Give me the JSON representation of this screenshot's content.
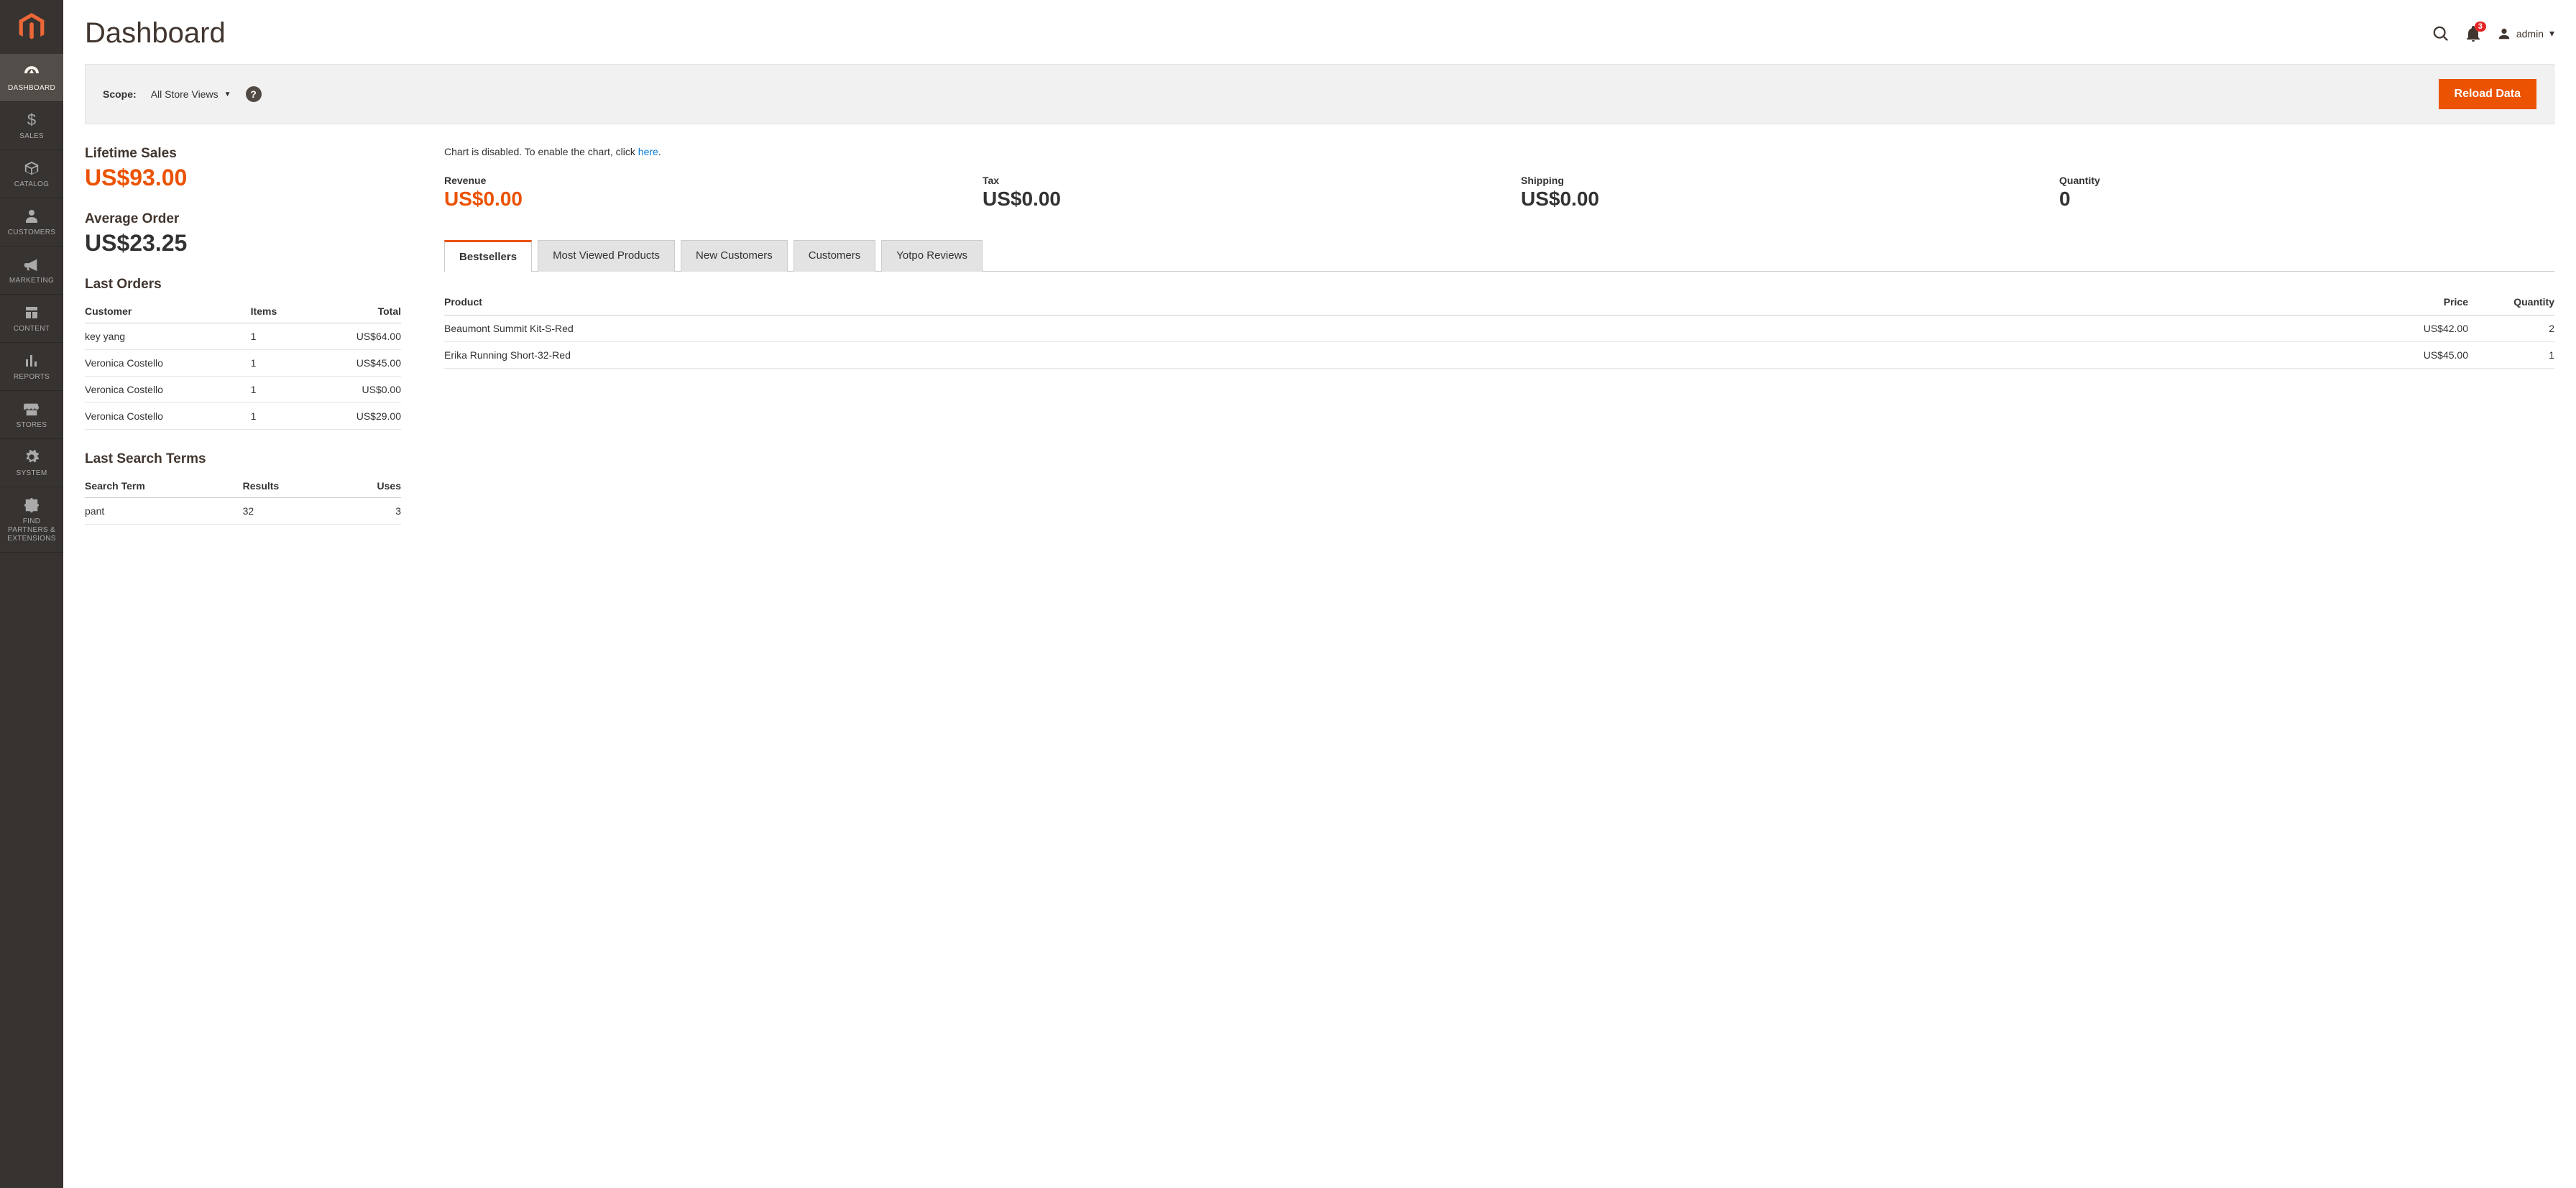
{
  "sidebar": {
    "items": [
      {
        "label": "DASHBOARD"
      },
      {
        "label": "SALES"
      },
      {
        "label": "CATALOG"
      },
      {
        "label": "CUSTOMERS"
      },
      {
        "label": "MARKETING"
      },
      {
        "label": "CONTENT"
      },
      {
        "label": "REPORTS"
      },
      {
        "label": "STORES"
      },
      {
        "label": "SYSTEM"
      },
      {
        "label": "FIND PARTNERS & EXTENSIONS"
      }
    ]
  },
  "header": {
    "title": "Dashboard",
    "notif_count": "3",
    "user_label": "admin"
  },
  "scope": {
    "label": "Scope:",
    "selected": "All Store Views",
    "reload_label": "Reload Data"
  },
  "stats": {
    "lifetime_label": "Lifetime Sales",
    "lifetime_value": "US$93.00",
    "avg_label": "Average Order",
    "avg_value": "US$23.25"
  },
  "last_orders": {
    "title": "Last Orders",
    "cols": {
      "customer": "Customer",
      "items": "Items",
      "total": "Total"
    },
    "rows": [
      {
        "customer": "key yang",
        "items": "1",
        "total": "US$64.00"
      },
      {
        "customer": "Veronica Costello",
        "items": "1",
        "total": "US$45.00"
      },
      {
        "customer": "Veronica Costello",
        "items": "1",
        "total": "US$0.00"
      },
      {
        "customer": "Veronica Costello",
        "items": "1",
        "total": "US$29.00"
      }
    ]
  },
  "last_search": {
    "title": "Last Search Terms",
    "cols": {
      "term": "Search Term",
      "results": "Results",
      "uses": "Uses"
    },
    "rows": [
      {
        "term": "pant",
        "results": "32",
        "uses": "3"
      }
    ]
  },
  "chart_msg": {
    "prefix": "Chart is disabled. To enable the chart, click ",
    "link": "here",
    "suffix": "."
  },
  "summary": {
    "revenue_label": "Revenue",
    "revenue_val": "US$0.00",
    "tax_label": "Tax",
    "tax_val": "US$0.00",
    "shipping_label": "Shipping",
    "shipping_val": "US$0.00",
    "qty_label": "Quantity",
    "qty_val": "0"
  },
  "tabs": {
    "items": [
      "Bestsellers",
      "Most Viewed Products",
      "New Customers",
      "Customers",
      "Yotpo Reviews"
    ]
  },
  "bestsellers": {
    "cols": {
      "product": "Product",
      "price": "Price",
      "qty": "Quantity"
    },
    "rows": [
      {
        "product": "Beaumont Summit Kit-S-Red",
        "price": "US$42.00",
        "qty": "2"
      },
      {
        "product": "Erika Running Short-32-Red",
        "price": "US$45.00",
        "qty": "1"
      }
    ]
  }
}
